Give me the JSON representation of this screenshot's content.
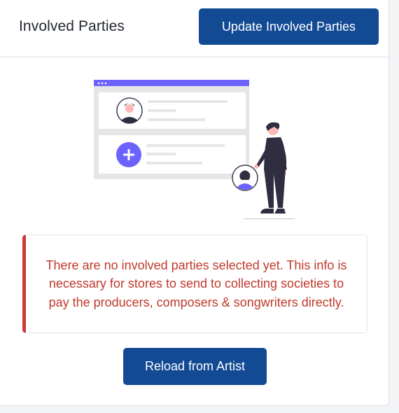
{
  "header": {
    "title": "Involved Parties",
    "update_button": "Update Involved Parties"
  },
  "empty_state": {
    "illustration_icons": [
      "person-icon",
      "plus-icon",
      "person-icon"
    ],
    "message": "There are no involved parties selected yet. This info is necessary for stores to send to collecting societies to pay the producers, composers & songwriters directly.",
    "reload_button": "Reload from Artist"
  },
  "colors": {
    "primary_button": "#124a93",
    "error_text": "#c0392b",
    "error_border": "#cc3a3a",
    "illustration_accent": "#6c63ff"
  }
}
